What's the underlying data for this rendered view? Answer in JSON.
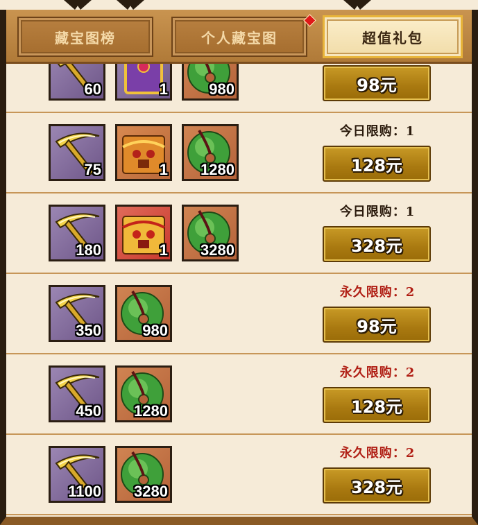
{
  "tabs": [
    {
      "label": "藏宝图榜",
      "active": false
    },
    {
      "label": "个人藏宝图",
      "active": false,
      "badge": true
    },
    {
      "label": "超值礼包",
      "active": true
    }
  ],
  "rows": [
    {
      "items": [
        {
          "icon": "pickaxe-icon",
          "qty": "60"
        },
        {
          "icon": "purple-chest-icon",
          "qty": "1"
        },
        {
          "icon": "jade-disc-icon",
          "qty": "980"
        }
      ],
      "limit_text": "",
      "limit_type": "",
      "price": "98元"
    },
    {
      "items": [
        {
          "icon": "pickaxe-icon",
          "qty": "75"
        },
        {
          "icon": "gold-chest-icon",
          "qty": "1"
        },
        {
          "icon": "jade-disc-icon",
          "qty": "1280"
        }
      ],
      "limit_text": "今日限购：1",
      "limit_type": "today",
      "price": "128元"
    },
    {
      "items": [
        {
          "icon": "pickaxe-icon",
          "qty": "180"
        },
        {
          "icon": "red-chest-icon",
          "qty": "1"
        },
        {
          "icon": "jade-disc-icon",
          "qty": "3280"
        }
      ],
      "limit_text": "今日限购：1",
      "limit_type": "today",
      "price": "328元"
    },
    {
      "items": [
        {
          "icon": "pickaxe-icon",
          "qty": "350"
        },
        {
          "icon": "jade-disc-icon",
          "qty": "980"
        }
      ],
      "limit_text": "永久限购：2",
      "limit_type": "forever",
      "price": "98元"
    },
    {
      "items": [
        {
          "icon": "pickaxe-icon",
          "qty": "450"
        },
        {
          "icon": "jade-disc-icon",
          "qty": "1280"
        }
      ],
      "limit_text": "永久限购：2",
      "limit_type": "forever",
      "price": "128元"
    },
    {
      "items": [
        {
          "icon": "pickaxe-icon",
          "qty": "1100"
        },
        {
          "icon": "jade-disc-icon",
          "qty": "3280"
        }
      ],
      "limit_text": "永久限购：2",
      "limit_type": "forever",
      "price": "328元"
    }
  ],
  "colors": {
    "limit_today": "#2a1a0c",
    "limit_forever": "#b01e14",
    "buy_button": "#a97910",
    "active_tab_border": "#e8b43a"
  }
}
